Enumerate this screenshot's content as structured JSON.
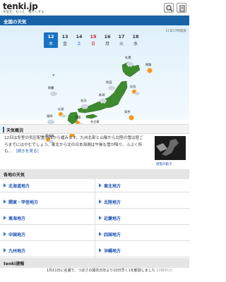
{
  "header": {
    "logo": "tenki.jp",
    "tagline": "天気を　もっと　楽しくする",
    "search_icon": "search-icon",
    "menu_icon": "menu-icon"
  },
  "title": "全国の天気",
  "map": {
    "timestamp": "11日17時発表",
    "days": [
      {
        "date": "12",
        "weekday": "木",
        "selected": true,
        "kind": "weekday"
      },
      {
        "date": "13",
        "weekday": "金",
        "selected": false,
        "kind": "weekday"
      },
      {
        "date": "14",
        "weekday": "土",
        "selected": false,
        "kind": "sat"
      },
      {
        "date": "15",
        "weekday": "日",
        "selected": false,
        "kind": "sun"
      },
      {
        "date": "16",
        "weekday": "月",
        "selected": false,
        "kind": "weekday"
      },
      {
        "date": "17",
        "weekday": "火",
        "selected": false,
        "kind": "weekday"
      },
      {
        "date": "18",
        "weekday": "水",
        "selected": false,
        "kind": "weekday"
      }
    ],
    "cities": [
      "札幌",
      "釧路",
      "秋田",
      "仙台",
      "新潟",
      "金沢",
      "東京",
      "名古屋",
      "大阪",
      "広島",
      "高知",
      "福岡",
      "鹿児島",
      "那覇"
    ]
  },
  "overview": {
    "heading": "天気概況",
    "text": "12日は冬型の気圧配置が西から緩みます。九州北部と山陰から北陸の雪は昼ごろまでにはやむでしょう。東北から北の日本海側は午後も雪が降り、ふぶく所も…",
    "more": "［続きを見る］",
    "sat_caption": "雨雲の動き"
  },
  "regions": {
    "heading": "各地の天気",
    "items": [
      "北海道地方",
      "東北地方",
      "関東・甲信地方",
      "北陸地方",
      "東海地方",
      "近畿地方",
      "中国地方",
      "四国地方",
      "九州地方",
      "沖縄地方"
    ]
  },
  "news": {
    "heading": "tenki速報",
    "text": "1月11日に名瀬で、つぼさの開花日年より10日早く1を観測しました",
    "time": "10時45分"
  }
}
